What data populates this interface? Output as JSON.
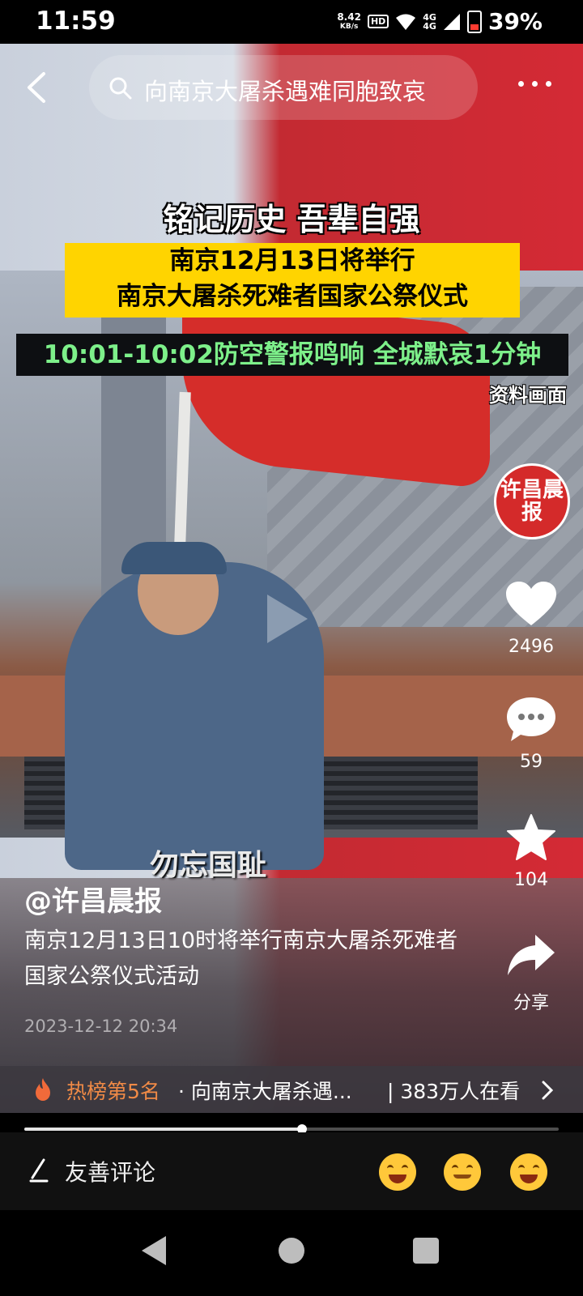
{
  "status_bar": {
    "time": "11:59",
    "net_speed": "8.42",
    "net_unit": "KB/s",
    "hd_label": "HD",
    "network_1": "4G",
    "network_2": "4G",
    "battery": "39%"
  },
  "search": {
    "query": "向南京大屠杀遇难同胞致哀"
  },
  "overlay": {
    "headline": "铭记历史 吾辈自强",
    "yellow_line1": "南京12月13日将举行",
    "yellow_line2": "南京大屠杀死难者国家公祭仪式",
    "alarm_line": "10:01-10:02防空警报鸣响 全城默哀1分钟",
    "source_label": "资料画面",
    "subtitle": "勿忘国耻"
  },
  "rail": {
    "avatar_text": "许昌晨报",
    "likes": "2496",
    "comments": "59",
    "favorites": "104",
    "share_label": "分享"
  },
  "post": {
    "author": "@许昌晨报",
    "description": "南京12月13日10时将举行南京大屠杀死难者国家公祭仪式活动",
    "date": "2023-12-12 20:34"
  },
  "hot": {
    "rank": "热榜第5名",
    "topic": "· 向南京大屠杀遇...",
    "watching": "| 383万人在看"
  },
  "progress": {
    "fraction": 0.52
  },
  "comment_bar": {
    "placeholder": "友善评论"
  },
  "colors": {
    "accent_orange": "#f08a46",
    "flag_red": "#d52d2a",
    "caption_yellow": "#ffd400",
    "alarm_green": "#7df08a"
  },
  "icons": [
    "back-arrow-icon",
    "search-icon",
    "more-icon",
    "heart-icon",
    "comment-icon",
    "star-icon",
    "share-icon",
    "fire-icon",
    "chevron-right-icon",
    "pen-icon",
    "laugh-emoji-icon",
    "smirk-emoji-icon",
    "grin-emoji-icon"
  ]
}
